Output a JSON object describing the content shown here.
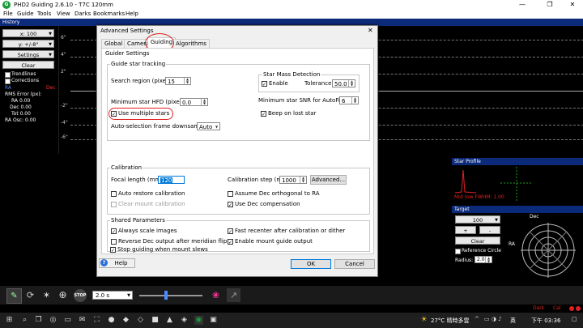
{
  "window": {
    "title": "PHD2 Guiding 2.6.10 - T7C 120mm",
    "app_icon": "G"
  },
  "window_controls": {
    "minimize": "—",
    "restore": "❐",
    "close": "✕"
  },
  "menu": [
    "File",
    "Guide",
    "Tools",
    "View",
    "Darks",
    "Bookmarks",
    "Help"
  ],
  "history": {
    "title": "History",
    "x_scale": "x: 100",
    "y_scale": "y: +/-8\"",
    "settings": "Settings",
    "clear": "Clear",
    "trendlines": "Trendlines",
    "corrections": "Corrections",
    "ra_label": "RA",
    "dec_label": "Dec",
    "rms_label": "RMS Error (px):",
    "ra_val": "RA 0.00",
    "dec_val": "Dec 0.00",
    "tot_val": "Tot 0.00",
    "ra_osc": "RA Osc: 0.00",
    "axis": [
      "6\"",
      "4\"",
      "2\"",
      "-2\"",
      "-4\"",
      "-6\""
    ],
    "colors": {
      "ra": "#4a8cff",
      "dec": "#ff3030"
    }
  },
  "dialog": {
    "title": "Advanced Settings",
    "close": "✕",
    "tabs": [
      "Global",
      "Camera",
      "Guiding",
      "Algorithms"
    ],
    "active_tab": "Guiding",
    "page_title": "Guider Settings",
    "star_tracking": {
      "title": "Guide star tracking",
      "search_region_label": "Search region (pixels):",
      "search_region": "15",
      "mass_title": "Star Mass Detection",
      "enable_label": "Enable",
      "tolerance_label": "Tolerance:",
      "tolerance": "50.0",
      "min_hfd_label": "Minimum star HFD (pixels):",
      "min_hfd": "0.0",
      "min_snr_label": "Minimum star SNR for AutoFind:",
      "min_snr": "6",
      "multi_stars_label": "Use multiple stars",
      "beep_label": "Beep on lost star",
      "downsample_label": "Auto-selection frame downsample:",
      "downsample": "Auto"
    },
    "calibration": {
      "title": "Calibration",
      "focal_label": "Focal length (mm):",
      "focal": "120",
      "step_label": "Calibration step (ms):",
      "step": "1000",
      "advanced": "Advanced...",
      "auto_restore": "Auto restore calibration",
      "assume_dec": "Assume Dec orthogonal to RA",
      "clear_mount": "Clear mount calibration",
      "use_dec_comp": "Use Dec compensation"
    },
    "shared": {
      "title": "Shared Parameters",
      "always_scale": "Always scale images",
      "fast_recenter": "Fast recenter after calibration or dither",
      "reverse_dec": "Reverse Dec output after meridian flip",
      "enable_mount": "Enable mount guide output",
      "stop_slews": "Stop guiding when mount slews"
    },
    "help": "Help",
    "ok": "OK",
    "cancel": "Cancel"
  },
  "star_profile": {
    "title": "Star Profile",
    "readout": "Mid row FWHM: 1.00"
  },
  "target": {
    "title": "Target",
    "scale": "100",
    "plus": "+",
    "minus": "-",
    "clear": "Clear",
    "ref_circle": "Reference Circle",
    "radius_label": "Radius:",
    "radius": "2.0",
    "dec_label": "Dec",
    "ra_label": "RA"
  },
  "toolbar": {
    "exposure": "2.0 s"
  },
  "status": {
    "dark": "Dark",
    "cal": "Cal"
  },
  "taskbar": {
    "temp": "27°C 晴時多雲",
    "time": "下午 03:36",
    "lang": "英"
  }
}
